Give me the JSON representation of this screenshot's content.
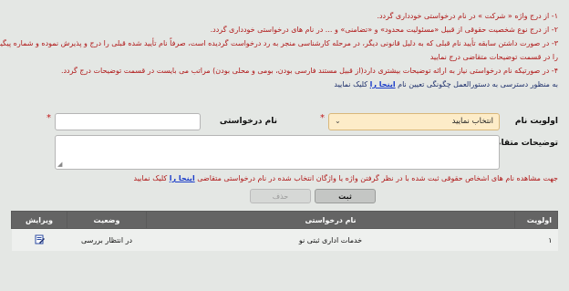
{
  "instructions": {
    "line1": "۱- از درج واژه « شرکت » در نام درخواستی خودداری گردد.",
    "line2": "۲- از درج نوع شخصیت حقوقی از قبیل «مسئولیت محدود» و «تضامنی» و ... در نام های درخواستی خودداری گردد.",
    "line3a": "۳- در صورت داشتن سابقه تأیید نام قبلی که به دلیل قانونی دیگر، در مرحله کارشناسی منجر به رد درخواست گردیده است، صرفاً نام تأیید شده قبلی را درج و پذیرش نموده و شماره پیگیری آن",
    "line3b": "را در قسمت توضیحات متقاضی درج نمایید",
    "line4": "۴- در صورتیکه نام درخواستی نیاز به ارائه توضیحات بیشتری دارد(از قبیل مستند فارسی بودن، بومی و محلی بودن) مراتب می بایست در قسمت توضیحات درج گردد.",
    "line5_pre": "به منظور دسترسی به دستورالعمل چگونگی تعیین نام",
    "line5_link": "اینجا را",
    "line5_post": "کلیک نمایید"
  },
  "form": {
    "priority_label": "اولویت نام",
    "priority_value": "انتخاب نمایید",
    "name_label": "نام درخواستی",
    "name_value": "",
    "desc_label": "توضیحات متقاضی",
    "desc_value": "",
    "required_mark": "*"
  },
  "note": {
    "pre": "جهت مشاهده نام های اشخاص حقوقی ثبت شده با در نظر گرفتن واژه یا واژگان انتخاب شده در نام درخواستی متقاضی",
    "link": "اینجا را",
    "post": "کلیک نمایید"
  },
  "buttons": {
    "save": "ثبت",
    "delete": "حذف"
  },
  "table": {
    "headers": {
      "priority": "اولویت",
      "name": "نام درخواستی",
      "status": "وضعیت",
      "edit": "ویرایش"
    },
    "rows": [
      {
        "priority": "۱",
        "name": "خدمات اداری ثبتی نو",
        "status": "در انتظار بررسی",
        "edit_icon": "edit-icon"
      }
    ]
  },
  "colors": {
    "error_red": "#b01818",
    "navy_text": "#1d2f6b",
    "link_blue": "#1a3cc9",
    "select_bg": "#fdecc8",
    "header_gray": "#646464"
  }
}
